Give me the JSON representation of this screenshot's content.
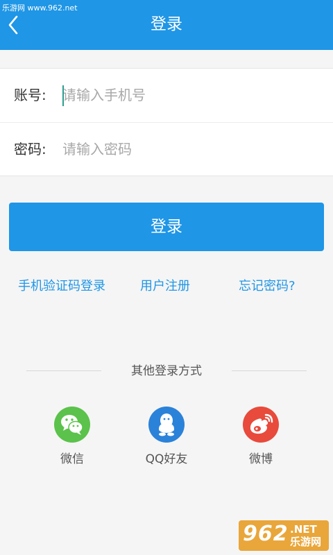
{
  "status_bar": {
    "site_text": "乐游网 www.962.net"
  },
  "header": {
    "title": "登录",
    "back_icon": "chevron-left-icon",
    "color": "#1f96e6"
  },
  "form": {
    "account": {
      "label": "账号:",
      "placeholder": "请输入手机号",
      "value": ""
    },
    "password": {
      "label": "密码:",
      "placeholder": "请输入密码",
      "value": ""
    }
  },
  "login_button": {
    "label": "登录",
    "color": "#1f96e6"
  },
  "links": {
    "sms_login": "手机验证码登录",
    "register": "用户注册",
    "forgot_password": "忘记密码?"
  },
  "other_login": {
    "title": "其他登录方式",
    "options": [
      {
        "label": "微信",
        "icon": "wechat-icon",
        "color": "#5bc24b"
      },
      {
        "label": "QQ好友",
        "icon": "qq-icon",
        "color": "#2b82d9"
      },
      {
        "label": "微博",
        "icon": "weibo-icon",
        "color": "#e84a3c"
      }
    ]
  },
  "watermark": {
    "number": "962",
    "suffix": ".NET",
    "cn": "乐游网"
  }
}
